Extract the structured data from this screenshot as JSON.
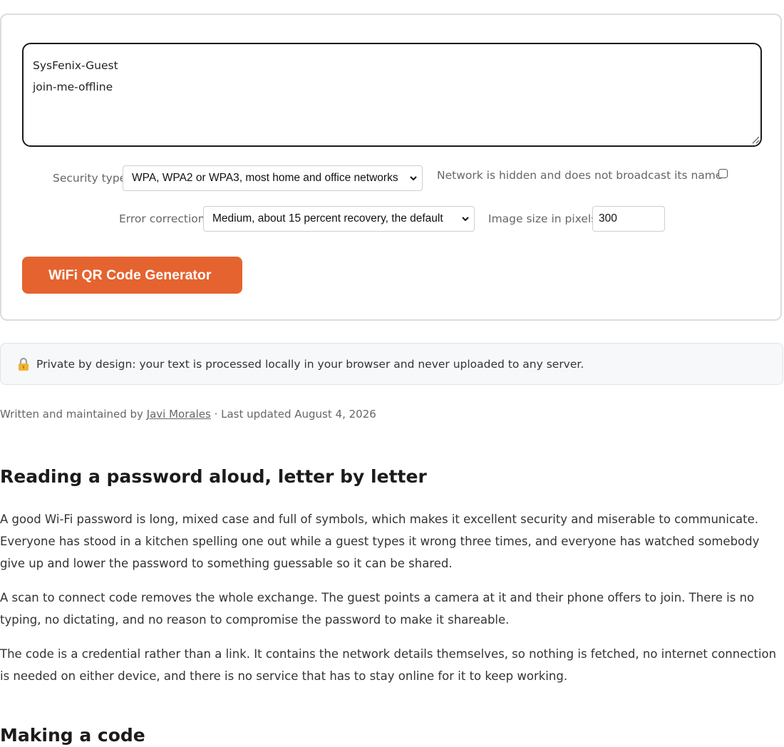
{
  "form": {
    "textarea_value": "SysFenix-Guest\njoin-me-offline",
    "security_label": "Security type",
    "security_selected": "WPA, WPA2 or WPA3, most home and office networks",
    "hidden_label": "Network is hidden and does not broadcast its name",
    "error_label": "Error correction",
    "error_selected": "Medium, about 15 percent recovery, the default",
    "size_label": "Image size in pixels",
    "size_value": "300",
    "generate_label": "WiFi QR Code Generator"
  },
  "privacy": {
    "text": "Private by design: your text is processed locally in your browser and never uploaded to any server.",
    "icon": "lock-icon"
  },
  "byline": {
    "prefix": "Written and maintained by ",
    "author": "Javi Morales",
    "separator": " · ",
    "updated": "Last updated August 4, 2026"
  },
  "article": {
    "section1_heading": "Reading a password aloud, letter by letter",
    "paragraphs": [
      "A good Wi-Fi password is long, mixed case and full of symbols, which makes it excellent security and miserable to communicate. Everyone has stood in a kitchen spelling one out while a guest types it wrong three times, and everyone has watched somebody give up and lower the password to something guessable so it can be shared.",
      "A scan to connect code removes the whole exchange. The guest points a camera at it and their phone offers to join. There is no typing, no dictating, and no reason to compromise the password to make it shareable.",
      "The code is a credential rather than a link. It contains the network details themselves, so nothing is fetched, no internet connection is needed on either device, and there is no service that has to stay online for it to keep working."
    ],
    "section2_heading": "Making a code"
  }
}
